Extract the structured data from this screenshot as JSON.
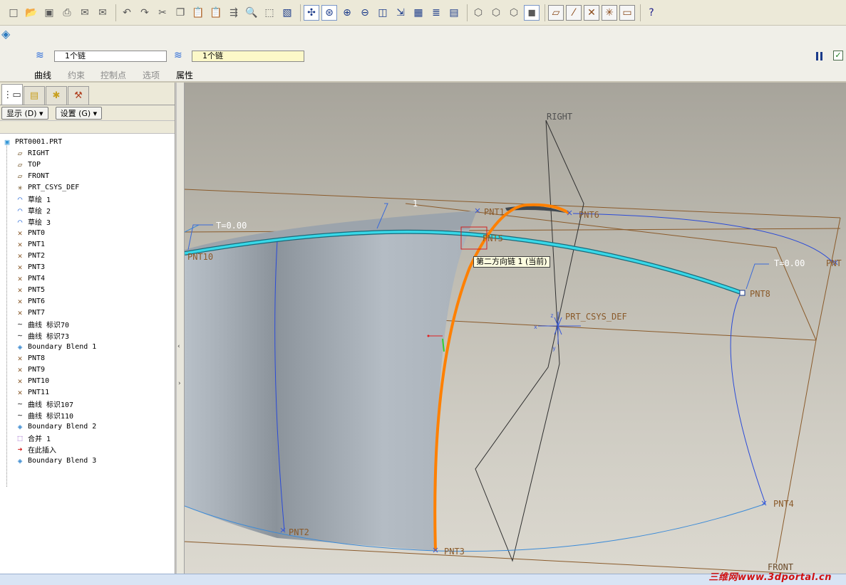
{
  "toolbar": {
    "icons": [
      "new-icon",
      "open-icon",
      "save-icon",
      "print-icon",
      "email-icon",
      "email-send-icon",
      "undo-icon",
      "redo-icon",
      "cut-icon",
      "copy-icon",
      "paste-icon",
      "paste-special-icon",
      "regenerate-icon",
      "find-icon",
      "select-box-icon",
      "repaint-icon",
      "spin-center-icon",
      "orient-icon",
      "zoom-in-icon",
      "zoom-out-icon",
      "refit-icon",
      "reorient-icon",
      "saved-views-icon",
      "layers-icon",
      "view-manager-icon",
      "wireframe-icon",
      "hidden-line-icon",
      "no-hidden-icon",
      "shading-icon",
      "datum-planes-icon",
      "datum-axes-icon",
      "datum-points-icon",
      "csys-icon",
      "annotations-icon",
      "whats-this-icon"
    ]
  },
  "dashboard": {
    "chain1_value": "1个链",
    "chain2_value": "1个链",
    "tabs": [
      {
        "label": "曲线"
      },
      {
        "label": "约束"
      },
      {
        "label": "控制点"
      },
      {
        "label": "选项"
      },
      {
        "label": "属性"
      }
    ]
  },
  "model_tree": {
    "show_button": "显示 (D) ▾",
    "settings_button": "设置 (G) ▾",
    "items": [
      {
        "label": "PRT0001.PRT",
        "icon": "part-icon",
        "color": "#3a9ad8"
      },
      {
        "label": "RIGHT",
        "icon": "datum-plane-icon",
        "color": "#6a4a1a"
      },
      {
        "label": "TOP",
        "icon": "datum-plane-icon",
        "color": "#6a4a1a"
      },
      {
        "label": "FRONT",
        "icon": "datum-plane-icon",
        "color": "#6a4a1a"
      },
      {
        "label": "PRT_CSYS_DEF",
        "icon": "csys-icon",
        "color": "#6a4a1a"
      },
      {
        "label": "草绘 1",
        "icon": "sketch-icon",
        "color": "#2a6ad8"
      },
      {
        "label": "草绘 2",
        "icon": "sketch-icon",
        "color": "#2a6ad8"
      },
      {
        "label": "草绘 3",
        "icon": "sketch-icon",
        "color": "#2a6ad8"
      },
      {
        "label": "PNT0",
        "icon": "datum-point-icon",
        "color": "#8a5a2a"
      },
      {
        "label": "PNT1",
        "icon": "datum-point-icon",
        "color": "#8a5a2a"
      },
      {
        "label": "PNT2",
        "icon": "datum-point-icon",
        "color": "#8a5a2a"
      },
      {
        "label": "PNT3",
        "icon": "datum-point-icon",
        "color": "#8a5a2a"
      },
      {
        "label": "PNT4",
        "icon": "datum-point-icon",
        "color": "#8a5a2a"
      },
      {
        "label": "PNT5",
        "icon": "datum-point-icon",
        "color": "#8a5a2a"
      },
      {
        "label": "PNT6",
        "icon": "datum-point-icon",
        "color": "#8a5a2a"
      },
      {
        "label": "PNT7",
        "icon": "datum-point-icon",
        "color": "#8a5a2a"
      },
      {
        "label": "曲线 标识70",
        "icon": "curve-icon",
        "color": "#303030"
      },
      {
        "label": "曲线 标识73",
        "icon": "curve-icon",
        "color": "#303030"
      },
      {
        "label": "Boundary Blend 1",
        "icon": "boundary-blend-icon",
        "color": "#3a8ad0"
      },
      {
        "label": "PNT8",
        "icon": "datum-point-icon",
        "color": "#8a5a2a"
      },
      {
        "label": "PNT9",
        "icon": "datum-point-icon",
        "color": "#8a5a2a"
      },
      {
        "label": "PNT10",
        "icon": "datum-point-icon",
        "color": "#8a5a2a"
      },
      {
        "label": "PNT11",
        "icon": "datum-point-icon",
        "color": "#8a5a2a"
      },
      {
        "label": "曲线 标识107",
        "icon": "curve-icon",
        "color": "#303030"
      },
      {
        "label": "曲线 标识110",
        "icon": "curve-icon",
        "color": "#303030"
      },
      {
        "label": "Boundary Blend 2",
        "icon": "boundary-blend-icon",
        "color": "#3a8ad0"
      },
      {
        "label": "合并 1",
        "icon": "merge-icon",
        "color": "#8a4ac0"
      },
      {
        "label": "在此插入",
        "icon": "insert-here-arrow-icon",
        "color": "#d01010"
      },
      {
        "label": "Boundary Blend 3",
        "icon": "boundary-blend-active-icon",
        "color": "#3a8ad0"
      }
    ]
  },
  "viewport": {
    "datum_right": "RIGHT",
    "datum_front": "FRONT",
    "csys_label": "PRT_CSYS_DEF",
    "csys_axes": {
      "x": "x",
      "y": "y",
      "z": "z"
    },
    "points": [
      "PNT1",
      "PNT6",
      "PNT5",
      "PNT10",
      "PNT8",
      "PNT2",
      "PNT3",
      "PNT4",
      "PNT"
    ],
    "tension_left": "T=0.00",
    "tension_right": "T=0.00",
    "chain_marker": "1",
    "tooltip": "第二方向链 1 (当前)",
    "curve_color": "#ff8000",
    "chain_color": "#38d8e8"
  },
  "watermark": "三维网www.3dportal.cn"
}
